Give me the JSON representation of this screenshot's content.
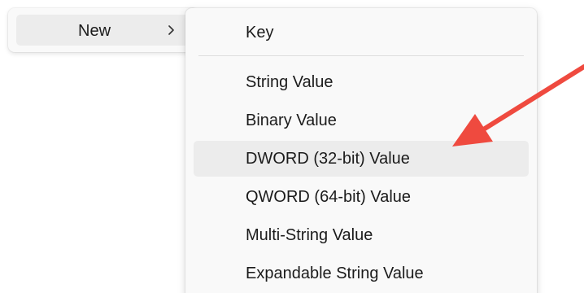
{
  "parent_menu": {
    "item_label": "New",
    "chevron_icon": "chevron-right-icon"
  },
  "submenu": {
    "items": [
      {
        "label": "Key"
      },
      {
        "label": "String Value"
      },
      {
        "label": "Binary Value"
      },
      {
        "label": "DWORD (32-bit) Value",
        "highlighted": true
      },
      {
        "label": "QWORD (64-bit) Value"
      },
      {
        "label": "Multi-String Value"
      },
      {
        "label": "Expandable String Value"
      }
    ]
  },
  "annotation": {
    "arrow_color": "#ef4a3f",
    "points_to": "DWORD (32-bit) Value"
  },
  "colors": {
    "menu_background": "#f9f9f9",
    "hover_background": "#ececec",
    "text": "#1b1b1b"
  }
}
